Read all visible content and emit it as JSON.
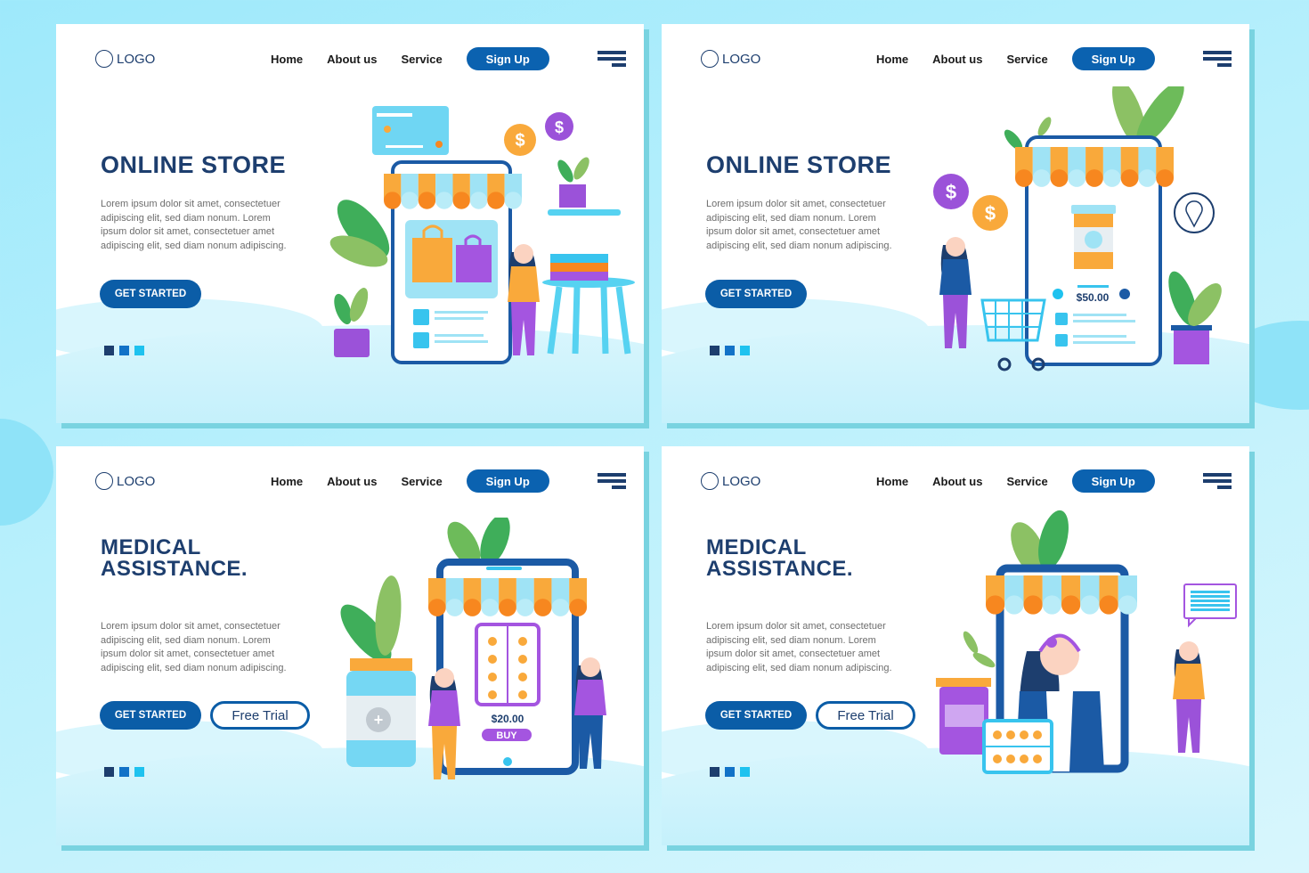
{
  "brand_colors": {
    "navy": "#1d3e6e",
    "primary": "#0b5da7",
    "accent_cyan": "#1ec2ef",
    "dot_mid": "#1272c7"
  },
  "cards": [
    {
      "nav": {
        "logo": "LOGO",
        "links": [
          "Home",
          "About us",
          "Service"
        ],
        "signup": "Sign Up"
      },
      "title_lines": [
        "ONLINE STORE"
      ],
      "description": [
        "Lorem ipsum dolor sit amet, consectetuer",
        "adipiscing elit, sed diam nonum. Lorem",
        "ipsum dolor sit amet, consectetuer amet",
        "adipiscing elit, sed diam nonum adipiscing."
      ],
      "cta": "GET STARTED",
      "illustration": {
        "icons": [
          "credit-card-icon",
          "dollar-coin-icon",
          "shopping-bag-icon",
          "storefront-phone-icon",
          "plant-icon",
          "table-icon",
          "books-icon"
        ]
      }
    },
    {
      "nav": {
        "logo": "LOGO",
        "links": [
          "Home",
          "About us",
          "Service"
        ],
        "signup": "Sign Up"
      },
      "title_lines": [
        "ONLINE STORE"
      ],
      "description": [
        "Lorem ipsum dolor sit amet, consectetuer",
        "adipiscing elit, sed diam nonum. Lorem",
        "ipsum dolor sit amet, consectetuer amet",
        "adipiscing elit, sed diam nonum adipiscing."
      ],
      "cta": "GET STARTED",
      "illustration": {
        "price": "$50.00",
        "icons": [
          "shopping-cart-icon",
          "location-pin-icon",
          "medicine-bottle-icon",
          "dollar-coin-icon"
        ]
      }
    },
    {
      "nav": {
        "logo": "LOGO",
        "links": [
          "Home",
          "About us",
          "Service"
        ],
        "signup": "Sign Up"
      },
      "title_lines": [
        "MEDICAL",
        "ASSISTANCE."
      ],
      "description": [
        "Lorem ipsum dolor sit amet, consectetuer",
        "adipiscing elit, sed diam nonum. Lorem",
        "ipsum dolor sit amet, consectetuer amet",
        "adipiscing elit, sed diam nonum adipiscing."
      ],
      "cta": "GET STARTED",
      "secondary_cta": "Free Trial",
      "illustration": {
        "price": "$20.00",
        "buy_label": "BUY",
        "icons": [
          "pill-pack-icon",
          "medicine-jar-icon",
          "tablet-device-icon"
        ]
      }
    },
    {
      "nav": {
        "logo": "LOGO",
        "links": [
          "Home",
          "About us",
          "Service"
        ],
        "signup": "Sign Up"
      },
      "title_lines": [
        "MEDICAL",
        "ASSISTANCE."
      ],
      "description": [
        "Lorem ipsum dolor sit amet, consectetuer",
        "adipiscing elit, sed diam nonum. Lorem",
        "ipsum dolor sit amet, consectetuer amet",
        "adipiscing elit, sed diam nonum adipiscing."
      ],
      "cta": "GET STARTED",
      "secondary_cta": "Free Trial",
      "illustration": {
        "icons": [
          "headset-agent-icon",
          "chat-bubble-icon",
          "pill-pack-icon",
          "medicine-jar-icon"
        ]
      }
    }
  ]
}
